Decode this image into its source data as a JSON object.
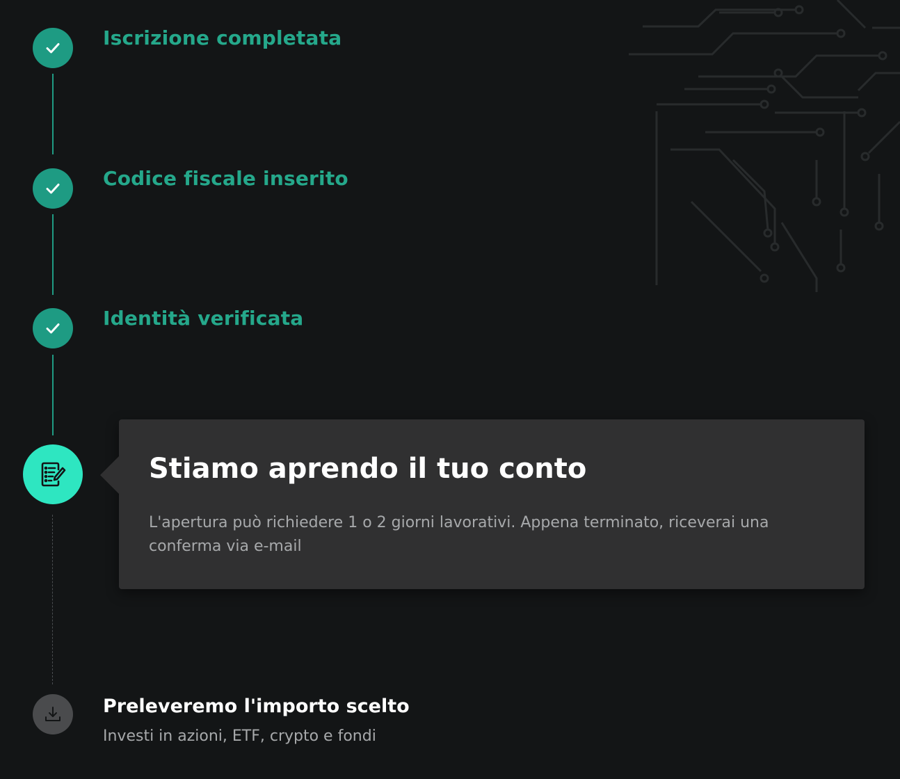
{
  "steps": [
    {
      "title": "Iscrizione completata",
      "status": "done",
      "icon": "check-icon"
    },
    {
      "title": "Codice fiscale inserito",
      "status": "done",
      "icon": "check-icon"
    },
    {
      "title": "Identità verificata",
      "status": "done",
      "icon": "check-icon"
    }
  ],
  "current_step": {
    "title": "Stiamo aprendo il tuo conto",
    "description": "L'apertura può richiedere 1 o 2 giorni lavorativi. Appena terminato, riceverai una conferma via e-mail",
    "icon": "document-edit-icon"
  },
  "next_step": {
    "title": "Preleveremo l'importo scelto",
    "subtitle": "Investi in azioni, ETF, crypto e fondi",
    "icon": "download-icon"
  },
  "colors": {
    "background": "#131516",
    "done": "#1e9b83",
    "done_text": "#25a88b",
    "active": "#2ee6c1",
    "pending": "#4a4b4d",
    "card": "#303031"
  }
}
